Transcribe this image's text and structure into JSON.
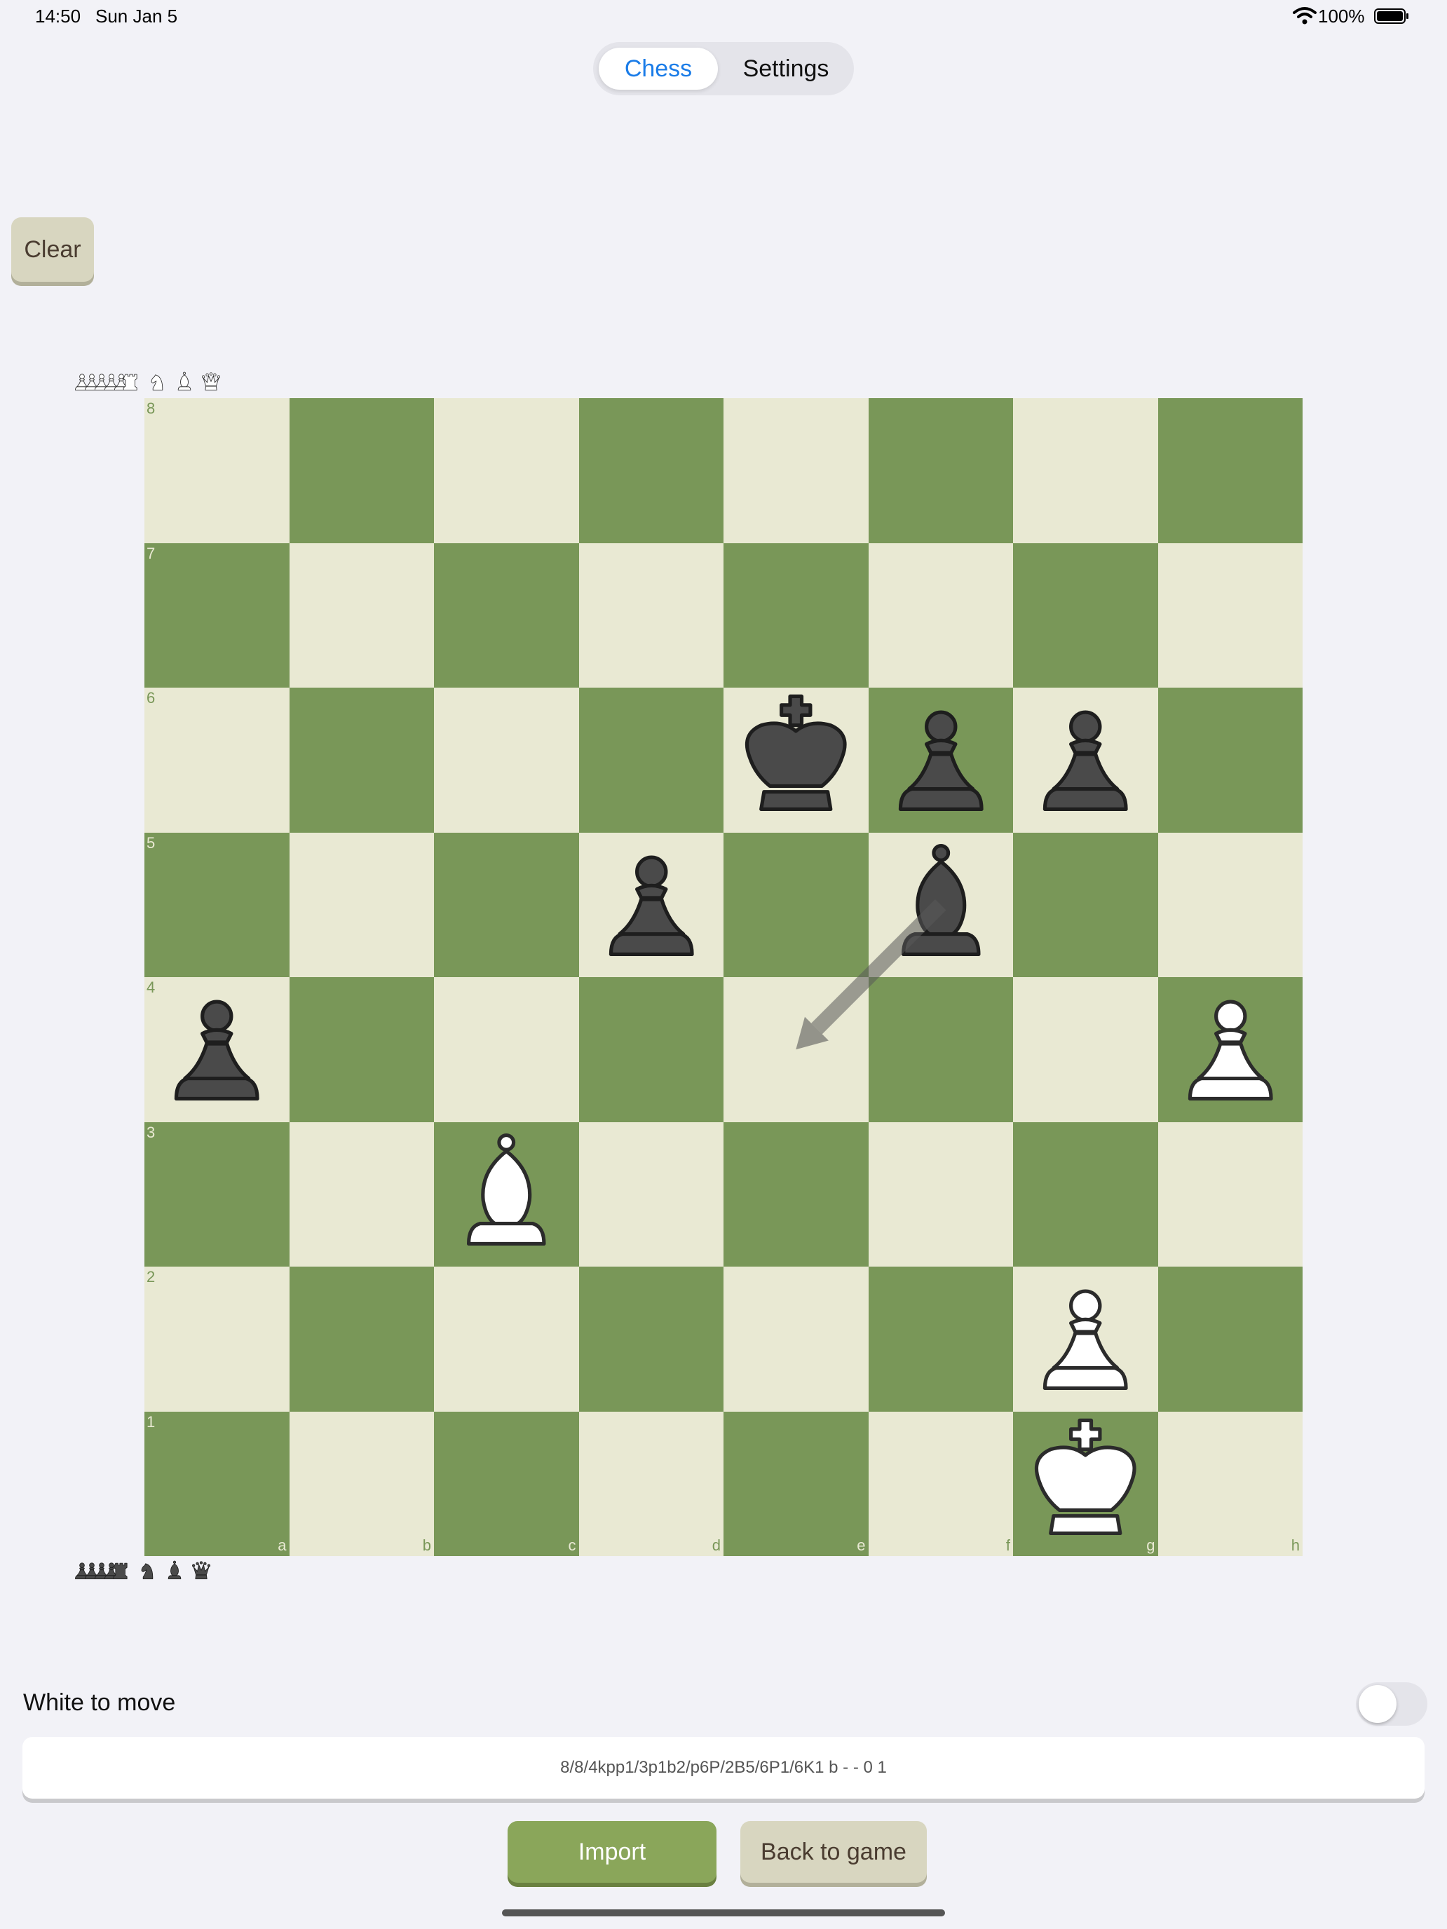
{
  "status_bar": {
    "time": "14:50",
    "date": "Sun Jan 5",
    "battery": "100%"
  },
  "tabs": [
    {
      "label": "Chess",
      "selected": true
    },
    {
      "label": "Settings",
      "selected": false
    }
  ],
  "toolbar": {
    "clear_label": "Clear"
  },
  "board": {
    "ranks": [
      "8",
      "7",
      "6",
      "5",
      "4",
      "3",
      "2",
      "1"
    ],
    "files": [
      "a",
      "b",
      "c",
      "d",
      "e",
      "f",
      "g",
      "h"
    ],
    "pieces": {
      "e6": "black-king",
      "f6": "black-pawn",
      "g6": "black-pawn",
      "d5": "black-pawn",
      "f5": "black-bishop",
      "a4": "black-pawn",
      "h4": "white-pawn",
      "c3": "white-bishop",
      "g2": "white-pawn",
      "g1": "white-king"
    },
    "arrow": {
      "from": "f5",
      "to": "e4"
    }
  },
  "captured": {
    "top": [
      "white-pawn",
      "white-pawn",
      "white-pawn",
      "white-pawn",
      "white-pawn",
      "white-rook",
      "white-knight",
      "white-bishop",
      "white-queen"
    ],
    "bottom": [
      "black-pawn",
      "black-pawn",
      "black-pawn",
      "black-pawn",
      "black-rook",
      "black-knight",
      "black-bishop",
      "black-queen"
    ]
  },
  "side_to_move": {
    "label": "White to move",
    "toggle_on": false
  },
  "fen": {
    "value": "8/8/4kpp1/3p1b2/p6P/2B5/6P1/6K1 b - - 0 1"
  },
  "actions": {
    "import_label": "Import",
    "back_label": "Back to game"
  },
  "colors": {
    "light_square": "#e9e9d3",
    "dark_square": "#799758",
    "accent": "#1a7ce8",
    "import_button": "#8aa65a"
  }
}
